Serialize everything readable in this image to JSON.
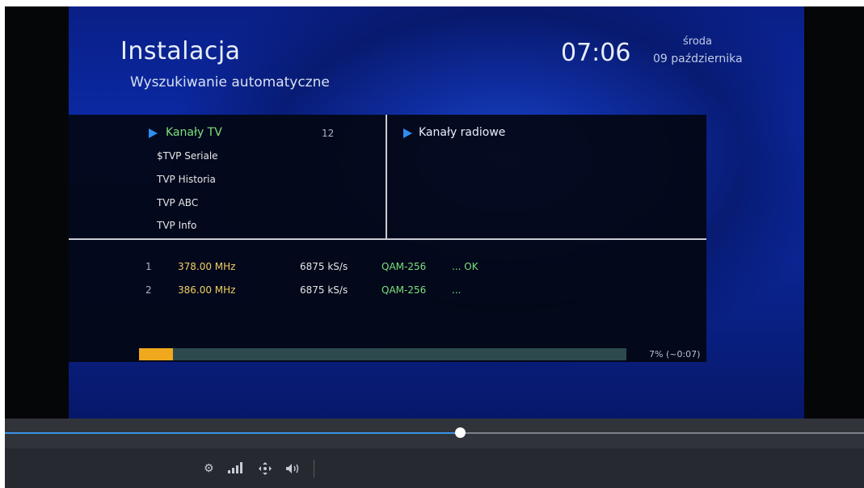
{
  "osd": {
    "title": "Instalacja",
    "subtitle": "Wyszukiwanie automatyczne",
    "time": "07:06",
    "day": "środa",
    "date": "09 października"
  },
  "tv_panel": {
    "header": "Kanały TV",
    "count": "12",
    "items": [
      "$TVP Seriale",
      "TVP Historia",
      "TVP ABC",
      "TVP Info"
    ]
  },
  "radio_panel": {
    "header": "Kanały radiowe"
  },
  "scan_rows": [
    {
      "num": "1",
      "freq": "378.00 MHz",
      "symbol_rate": "6875 kS/s",
      "modulation": "QAM-256",
      "status": "... OK"
    },
    {
      "num": "2",
      "freq": "386.00 MHz",
      "symbol_rate": "6875 kS/s",
      "modulation": "QAM-256",
      "status": "..."
    }
  ],
  "progress": {
    "percent": 7,
    "label": "7% (~0:07)"
  },
  "player": {
    "seek_position": 0.53,
    "controls": [
      "gear-icon",
      "signal-bars-icon",
      "move-icon",
      "volume-icon"
    ]
  },
  "colors": {
    "accent_blue": "#2f8cf0",
    "progress_orange": "#f0a81c",
    "text_green": "#7ee07a",
    "text_yellow": "#f0d060"
  }
}
